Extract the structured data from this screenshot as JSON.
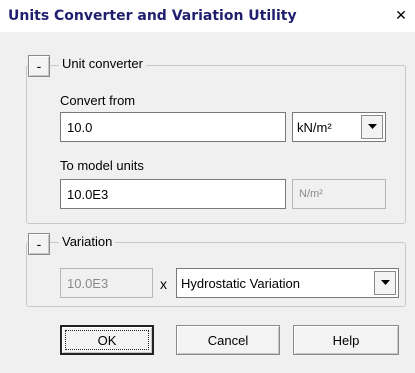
{
  "window": {
    "title": "Units Converter and Variation Utility",
    "close_glyph": "✕"
  },
  "unit_converter": {
    "collapse_label": "-",
    "legend": "Unit converter",
    "convert_from_label": "Convert from",
    "convert_from_value": "10.0",
    "from_unit": "kN/m²",
    "to_model_label": "To model units",
    "to_model_value": "10.0E3",
    "model_unit": "N/m²"
  },
  "variation": {
    "collapse_label": "-",
    "legend": "Variation",
    "factor_value": "10.0E3",
    "multiply_sign": "x",
    "variation_type": "Hydrostatic Variation"
  },
  "buttons": {
    "ok": "OK",
    "cancel": "Cancel",
    "help": "Help"
  },
  "icons": {
    "close": "close-icon",
    "dropdown": "chevron-down-icon"
  }
}
